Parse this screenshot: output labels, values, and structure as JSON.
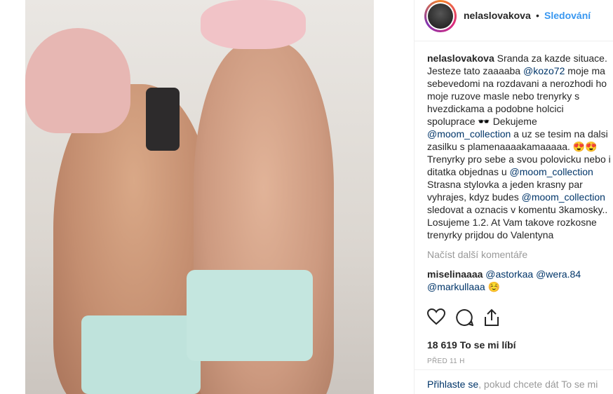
{
  "header": {
    "username": "nelaslovakova",
    "dot": "•",
    "follow": "Sledování"
  },
  "caption": {
    "username": "nelaslovakova",
    "p1": " Sranda za kazde situace. Jesteze tato zaaaaba ",
    "m1": "@kozo72",
    "p2": " moje ma sebevedomi na rozdavani a nerozhodi ho moje ruzove masle nebo trenyrky s hvezdickama a podobne holcici spoluprace 🕶️ Dekujeme ",
    "m2": "@moom_collection",
    "p3": " a uz se tesim na dalsi zasilku s plamenaaaakamaaaaa. 😍😍 Trenyrky pro sebe a svou polovicku nebo i ditatka objednas u ",
    "m3": "@moom_collection",
    "p4": " Strasna stylovka a jeden krasny par vyhrajes, kdyz budes ",
    "m4": "@moom_collection",
    "p5": " sledovat a oznacis v komentu 3kamosky.. Losujeme 1.2. At Vam takove rozkosne trenyrky prijdou do Valentyna"
  },
  "load_more": "Načíst další komentáře",
  "reply": {
    "username": "miselinaaaa",
    "m1": "@astorkaa",
    "m2": "@wera.84",
    "m3": "@markullaaa",
    "emoji": "☺️"
  },
  "actions": {
    "like_icon": "heart-icon",
    "comment_icon": "comment-icon",
    "share_icon": "share-icon"
  },
  "likes": "18 619 To se mi líbí",
  "time": "PŘED 11 H",
  "login": {
    "link": "Přihlaste se",
    "rest": ", pokud chcete dát To se mi"
  }
}
